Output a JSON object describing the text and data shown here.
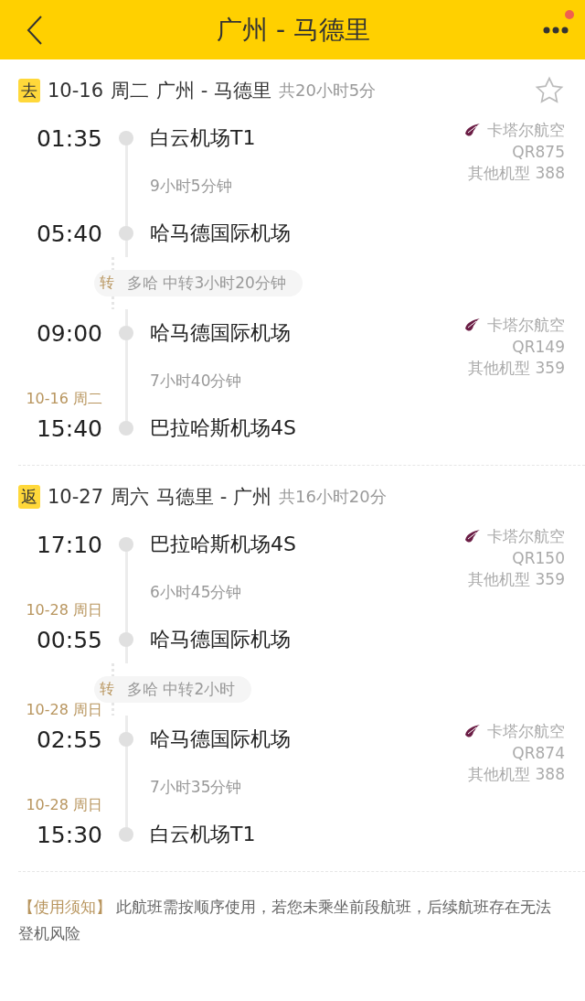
{
  "header": {
    "title": "广州 - 马德里",
    "notification": true
  },
  "journeys": [
    {
      "tag": "去",
      "date": "10-16",
      "weekday": "周二",
      "route": "广州 - 马德里",
      "total": "共20小时5分",
      "favorited": false,
      "legs": [
        {
          "kind": "flight",
          "depart": {
            "time": "01:35",
            "airport": "白云机场T1"
          },
          "duration": "9小时5分钟",
          "arrive": {
            "time": "05:40",
            "airport": "哈马德国际机场"
          },
          "airline": "卡塔尔航空",
          "flight_no": "QR875",
          "aircraft": "其他机型 388"
        },
        {
          "kind": "transfer",
          "mark": "转",
          "text": "多哈 中转3小时20分钟"
        },
        {
          "kind": "flight",
          "depart": {
            "time": "09:00",
            "airport": "哈马德国际机场"
          },
          "duration": "7小时40分钟",
          "arrive": {
            "date": "10-16 周二",
            "time": "15:40",
            "airport": "巴拉哈斯机场4S"
          },
          "airline": "卡塔尔航空",
          "flight_no": "QR149",
          "aircraft": "其他机型 359"
        }
      ]
    },
    {
      "tag": "返",
      "date": "10-27",
      "weekday": "周六",
      "route": "马德里 - 广州",
      "total": "共16小时20分",
      "legs": [
        {
          "kind": "flight",
          "depart": {
            "time": "17:10",
            "airport": "巴拉哈斯机场4S"
          },
          "duration": "6小时45分钟",
          "arrive": {
            "date": "10-28 周日",
            "time": "00:55",
            "airport": "哈马德国际机场"
          },
          "airline": "卡塔尔航空",
          "flight_no": "QR150",
          "aircraft": "其他机型 359"
        },
        {
          "kind": "transfer",
          "mark": "转",
          "text": "多哈 中转2小时"
        },
        {
          "kind": "flight",
          "depart": {
            "date": "10-28 周日",
            "time": "02:55",
            "airport": "哈马德国际机场"
          },
          "duration": "7小时35分钟",
          "arrive": {
            "date": "10-28 周日",
            "time": "15:30",
            "airport": "白云机场T1"
          },
          "airline": "卡塔尔航空",
          "flight_no": "QR874",
          "aircraft": "其他机型 388"
        }
      ]
    }
  ],
  "notice": {
    "label": "【使用须知】",
    "text": "此航班需按顺序使用，若您未乘坐前段航班，后续航班存在无法登机风险"
  }
}
